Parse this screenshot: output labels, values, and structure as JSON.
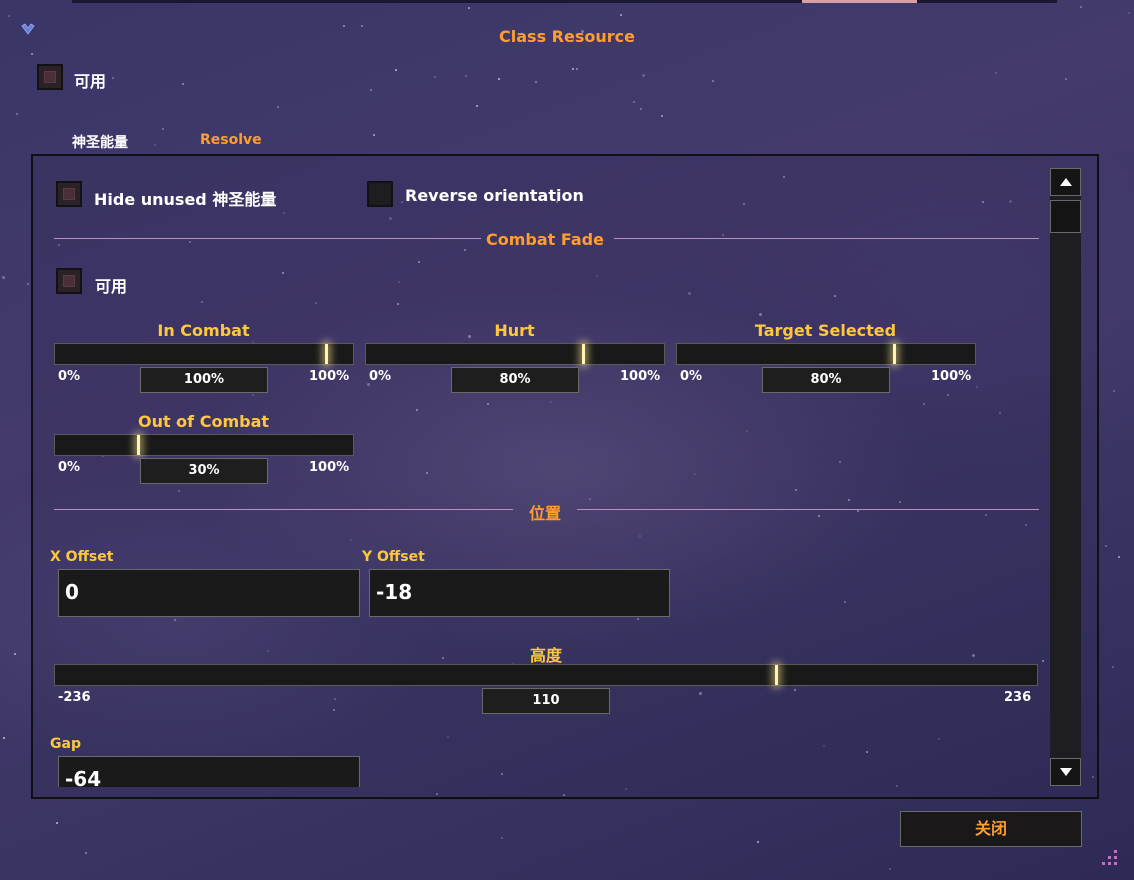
{
  "window": {
    "title": "Class Resource",
    "enabled_label": "可用",
    "close_label": "关闭"
  },
  "tabs": [
    {
      "label": "神圣能量",
      "color": "#ffffff",
      "active": true
    },
    {
      "label": "Resolve",
      "color": "#ff9e2a",
      "active": false
    }
  ],
  "panel": {
    "hide_unused_label": "Hide unused 神圣能量",
    "reverse_label": "Reverse orientation",
    "combat_fade": {
      "title": "Combat Fade",
      "enabled_label": "可用",
      "sliders": [
        {
          "label": "In Combat",
          "value": 100,
          "value_text": "100%",
          "min": "0%",
          "max": "100%"
        },
        {
          "label": "Hurt",
          "value": 80,
          "value_text": "80%",
          "min": "0%",
          "max": "100%"
        },
        {
          "label": "Target Selected",
          "value": 80,
          "value_text": "80%",
          "min": "0%",
          "max": "100%"
        },
        {
          "label": "Out of Combat",
          "value": 30,
          "value_text": "30%",
          "min": "0%",
          "max": "100%"
        }
      ]
    },
    "position": {
      "title": "位置",
      "x_offset_label": "X Offset",
      "x_offset_value": "0",
      "y_offset_label": "Y Offset",
      "y_offset_value": "-18",
      "height": {
        "label": "高度",
        "value": 110,
        "value_text": "110",
        "min": "-236",
        "max": "236",
        "min_num": -236,
        "max_num": 236
      },
      "gap_label": "Gap",
      "gap_value": "-64"
    }
  },
  "colors": {
    "accent": "#ff9e2a",
    "slider_label": "#ffc83a",
    "divider": "#b891c0"
  }
}
